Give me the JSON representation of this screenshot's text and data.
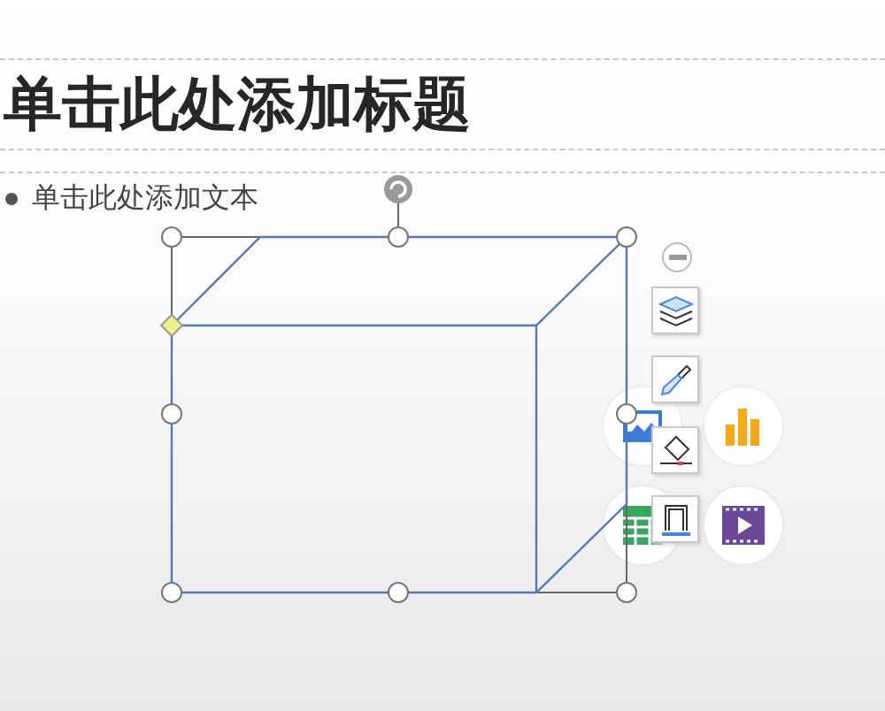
{
  "slide": {
    "title": "单击此处添加标题",
    "body_bullets": [
      "单击此处添加文本"
    ]
  }
}
